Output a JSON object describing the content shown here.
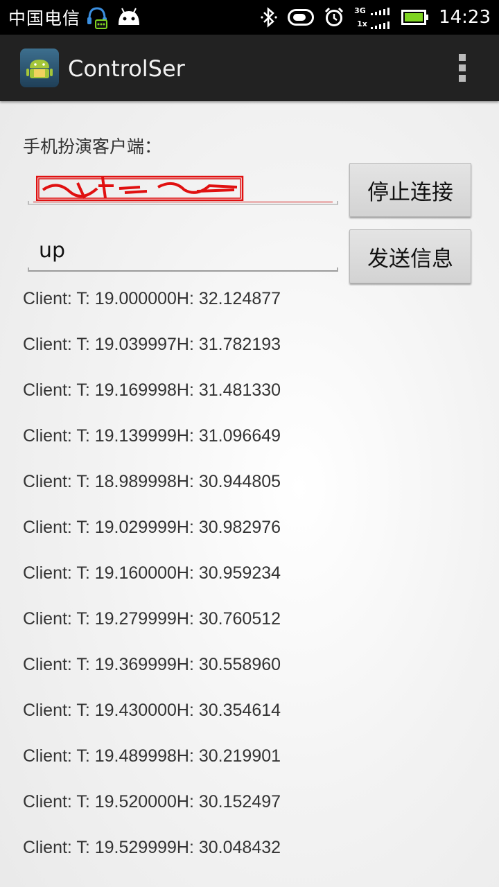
{
  "status_bar": {
    "carrier": "中国电信",
    "network_label_top": "3G",
    "network_label_bottom": "1x",
    "time": "14:23",
    "icons": [
      "headset-icon",
      "android-icon",
      "bluetooth-icon",
      "toggle-icon",
      "alarm-icon",
      "signal-icon",
      "battery-icon"
    ],
    "battery_color": "#7ed321"
  },
  "action_bar": {
    "title": "ControlSer",
    "app_icon": "android-app-icon",
    "overflow_icon": "overflow-menu-icon"
  },
  "main": {
    "client_label": "手机扮演客户端：",
    "message_input_value": "up",
    "stop_button_label": "停止连接",
    "send_button_label": "发送信息",
    "log_lines": [
      "Client: T: 19.000000H: 32.124877",
      "Client: T: 19.039997H: 31.782193",
      "Client: T: 19.169998H: 31.481330",
      "Client: T: 19.139999H: 31.096649",
      "Client: T: 18.989998H: 30.944805",
      "Client: T: 19.029999H: 30.982976",
      "Client: T: 19.160000H: 30.959234",
      "Client: T: 19.279999H: 30.760512",
      "Client: T: 19.369999H: 30.558960",
      "Client: T: 19.430000H: 30.354614",
      "Client: T: 19.489998H: 30.219901",
      "Client: T: 19.520000H: 30.152497",
      "Client: T: 19.529999H: 30.048432"
    ]
  }
}
